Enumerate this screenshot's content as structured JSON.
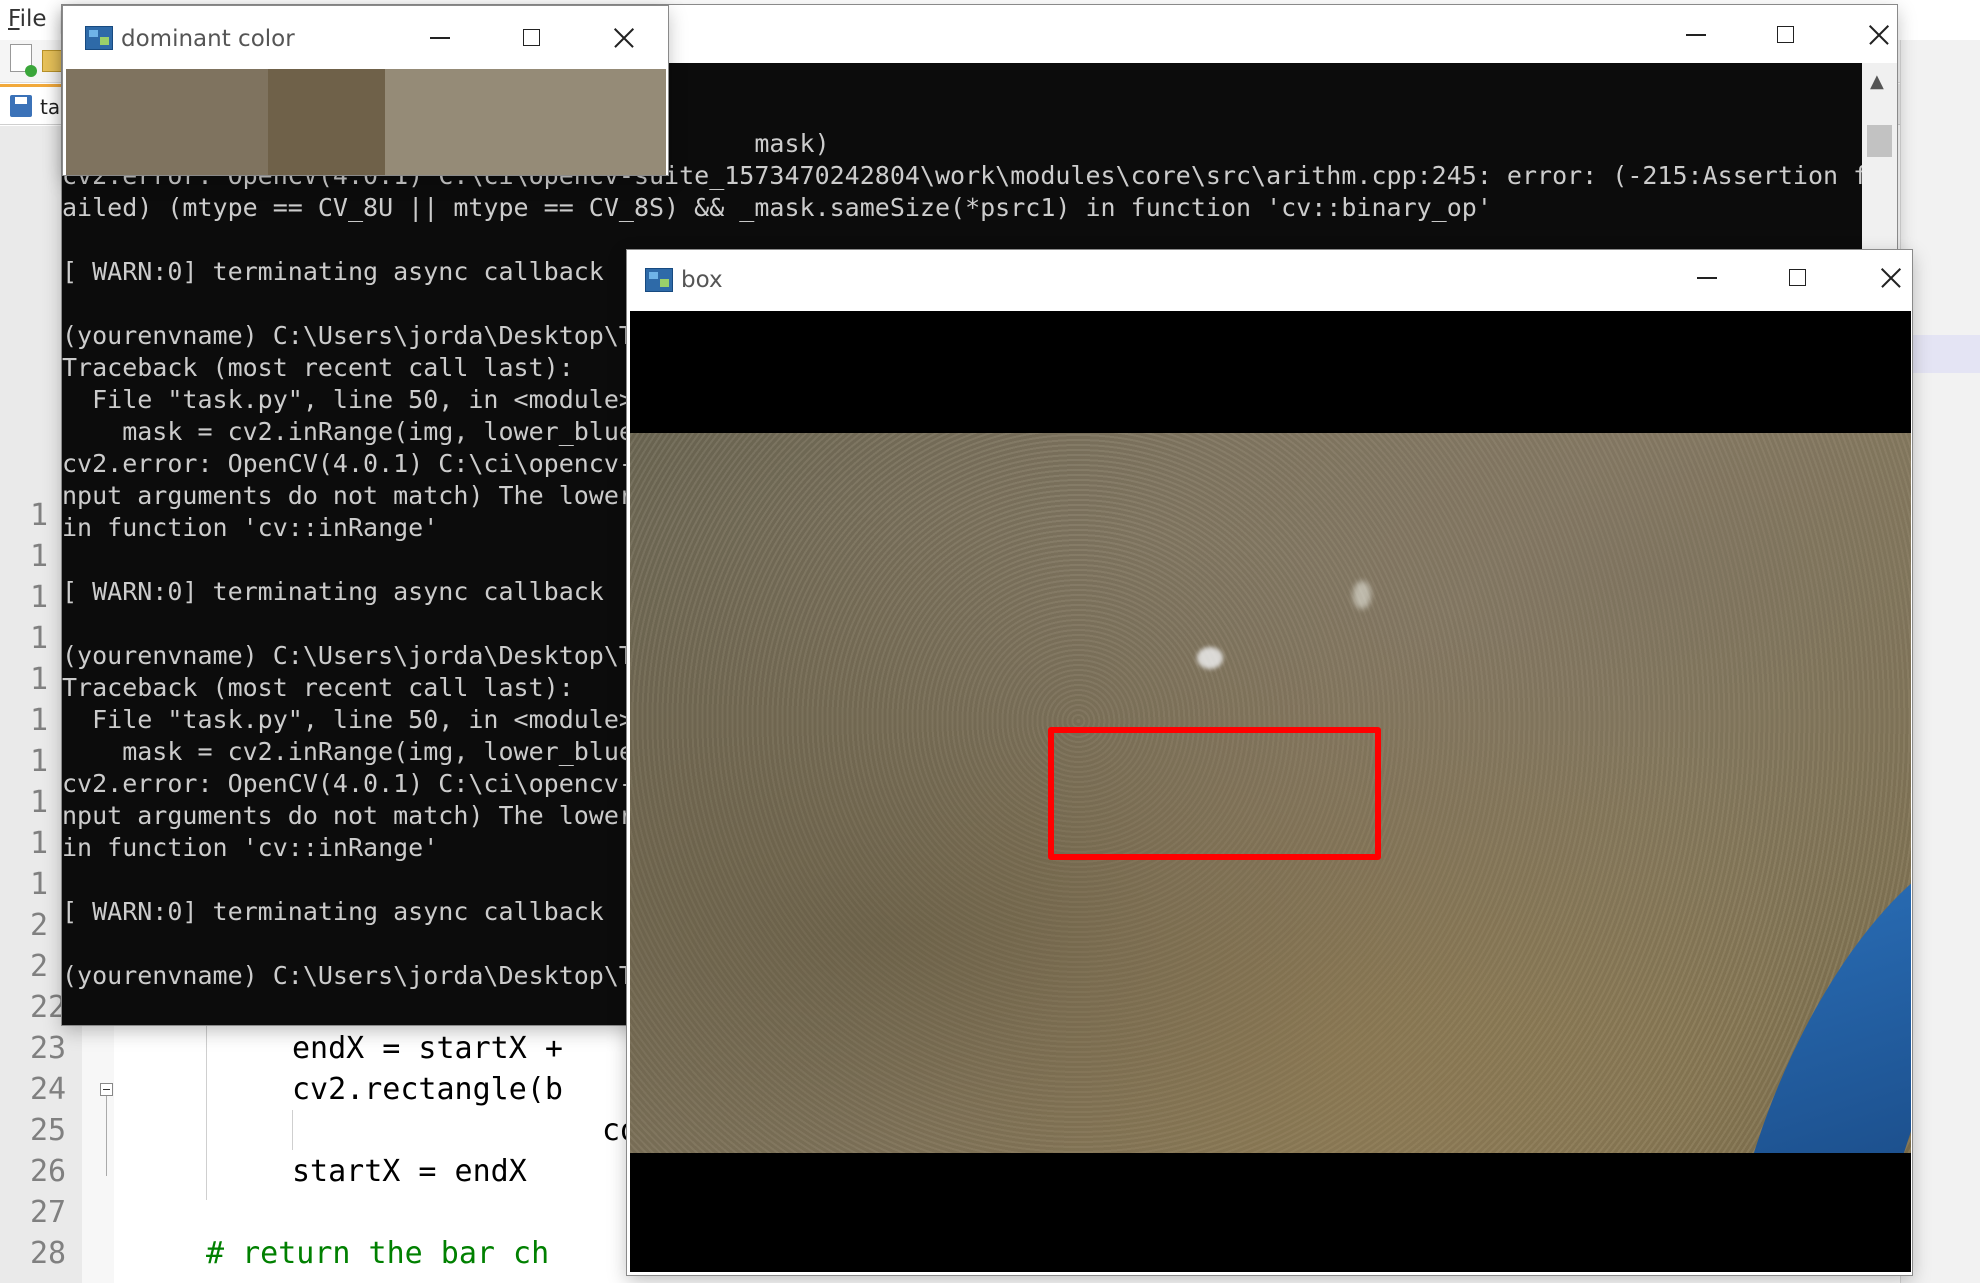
{
  "editor": {
    "menu_file": "File",
    "menu_sep": "|",
    "tab_label": "tas",
    "line_numbers": [
      "1",
      "1",
      "1",
      "1",
      "1",
      "1",
      "1",
      "1",
      "1",
      "1",
      "2",
      "2",
      "22",
      "23",
      "24",
      "25",
      "26",
      "27",
      "28"
    ],
    "code_lines": {
      "l23": "endX = startX +",
      "l24": "cv2.rectangle(b",
      "l25": "co",
      "l26": "startX = endX",
      "l28": "# return the bar ch"
    }
  },
  "console_window": {
    "lines": [
      "                                              mask)",
      "cv2.error: OpenCV(4.0.1) C:\\ci\\opencv-suite_1573470242804\\work\\modules\\core\\src\\arithm.cpp:245: error: (-215:Assertion f",
      "ailed) (mtype == CV_8U || mtype == CV_8S) && _mask.sameSize(*psrc1) in function 'cv::binary_op'",
      "",
      "[ WARN:0] terminating async callback",
      "",
      "(yourenvname) C:\\Users\\jorda\\Desktop\\T",
      "Traceback (most recent call last):",
      "  File \"task.py\", line 50, in <module>",
      "    mask = cv2.inRange(img, lower_blue",
      "cv2.error: OpenCV(4.0.1) C:\\ci\\opencv-",
      "nput arguments do not match) The lower",
      "in function 'cv::inRange'",
      "",
      "[ WARN:0] terminating async callback",
      "",
      "(yourenvname) C:\\Users\\jorda\\Desktop\\T",
      "Traceback (most recent call last):",
      "  File \"task.py\", line 50, in <module>",
      "    mask = cv2.inRange(img, lower_blue",
      "cv2.error: OpenCV(4.0.1) C:\\ci\\opencv-",
      "nput arguments do not match) The lower",
      "in function 'cv::inRange'",
      "",
      "[ WARN:0] terminating async callback",
      "",
      "(yourenvname) C:\\Users\\jorda\\Desktop\\T"
    ]
  },
  "dominant_window": {
    "title": "dominant color",
    "swatches": [
      {
        "color": "#7f735f",
        "fraction": 0.337
      },
      {
        "color": "#6f6149",
        "fraction": 0.195
      },
      {
        "color": "#958b77",
        "fraction": 0.468
      }
    ]
  },
  "box_window": {
    "title": "box"
  },
  "colors": {
    "console_bg": "#0c0c0c",
    "console_text": "#cccccc",
    "roi_border": "#ff0000",
    "comment": "#008000"
  }
}
